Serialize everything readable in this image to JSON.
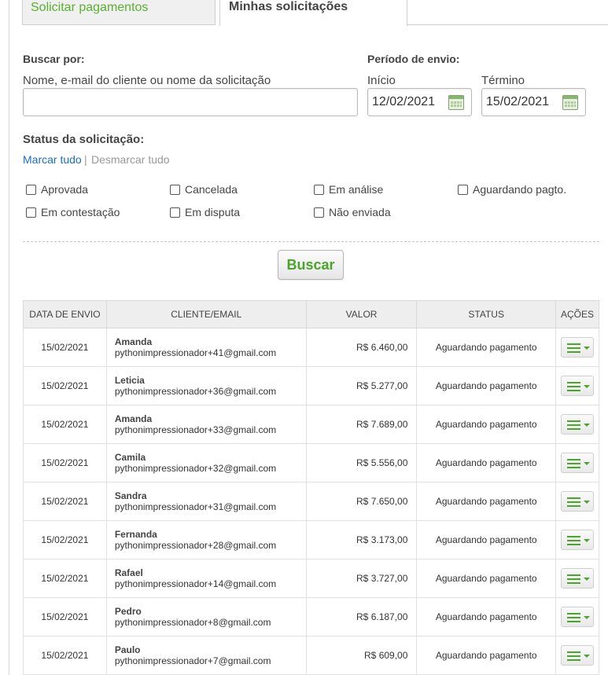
{
  "tabs": {
    "request_payments": "Solicitar pagamentos",
    "my_requests": "Minhas solicitações"
  },
  "search": {
    "search_by_label": "Buscar por:",
    "search_by_hint": "Nome, e-mail do cliente ou nome da solicitação",
    "search_value": "",
    "period_label": "Período de envio:",
    "start_label": "Início",
    "start_value": "12/02/2021",
    "end_label": "Término",
    "end_value": "15/02/2021"
  },
  "status_filter": {
    "label": "Status da solicitação:",
    "select_all": "Marcar tudo",
    "separator": "|",
    "deselect_all": "Desmarcar tudo",
    "options": [
      "Aprovada",
      "Cancelada",
      "Em análise",
      "Aguardando pagto.",
      "Em contestação",
      "Em disputa",
      "Não enviada"
    ]
  },
  "search_button": "Buscar",
  "table": {
    "headers": [
      "DATA DE ENVIO",
      "CLIENTE/EMAIL",
      "VALOR",
      "STATUS",
      "AÇÕES"
    ],
    "rows": [
      {
        "date": "15/02/2021",
        "name": "Amanda",
        "email": "pythonimpressionador+41@gmail.com",
        "value": "R$ 6.460,00",
        "status": "Aguardando pagamento"
      },
      {
        "date": "15/02/2021",
        "name": "Leticia",
        "email": "pythonimpressionador+36@gmail.com",
        "value": "R$ 5.277,00",
        "status": "Aguardando pagamento"
      },
      {
        "date": "15/02/2021",
        "name": "Amanda",
        "email": "pythonimpressionador+33@gmail.com",
        "value": "R$ 7.689,00",
        "status": "Aguardando pagamento"
      },
      {
        "date": "15/02/2021",
        "name": "Camila",
        "email": "pythonimpressionador+32@gmail.com",
        "value": "R$ 5.556,00",
        "status": "Aguardando pagamento"
      },
      {
        "date": "15/02/2021",
        "name": "Sandra",
        "email": "pythonimpressionador+31@gmail.com",
        "value": "R$ 7.650,00",
        "status": "Aguardando pagamento"
      },
      {
        "date": "15/02/2021",
        "name": "Fernanda",
        "email": "pythonimpressionador+28@gmail.com",
        "value": "R$ 3.173,00",
        "status": "Aguardando pagamento"
      },
      {
        "date": "15/02/2021",
        "name": "Rafael",
        "email": "pythonimpressionador+14@gmail.com",
        "value": "R$ 3.727,00",
        "status": "Aguardando pagamento"
      },
      {
        "date": "15/02/2021",
        "name": "Pedro",
        "email": "pythonimpressionador+8@gmail.com",
        "value": "R$ 6.187,00",
        "status": "Aguardando pagamento"
      },
      {
        "date": "15/02/2021",
        "name": "Paulo",
        "email": "pythonimpressionador+7@gmail.com",
        "value": "R$ 609,00",
        "status": "Aguardando pagamento"
      }
    ]
  },
  "icons": {
    "calendar": "calendar-icon",
    "actions": "hamburger-menu-icon"
  },
  "colors": {
    "accent_green": "#4aa52a",
    "link_blue": "#1a6fc2"
  }
}
